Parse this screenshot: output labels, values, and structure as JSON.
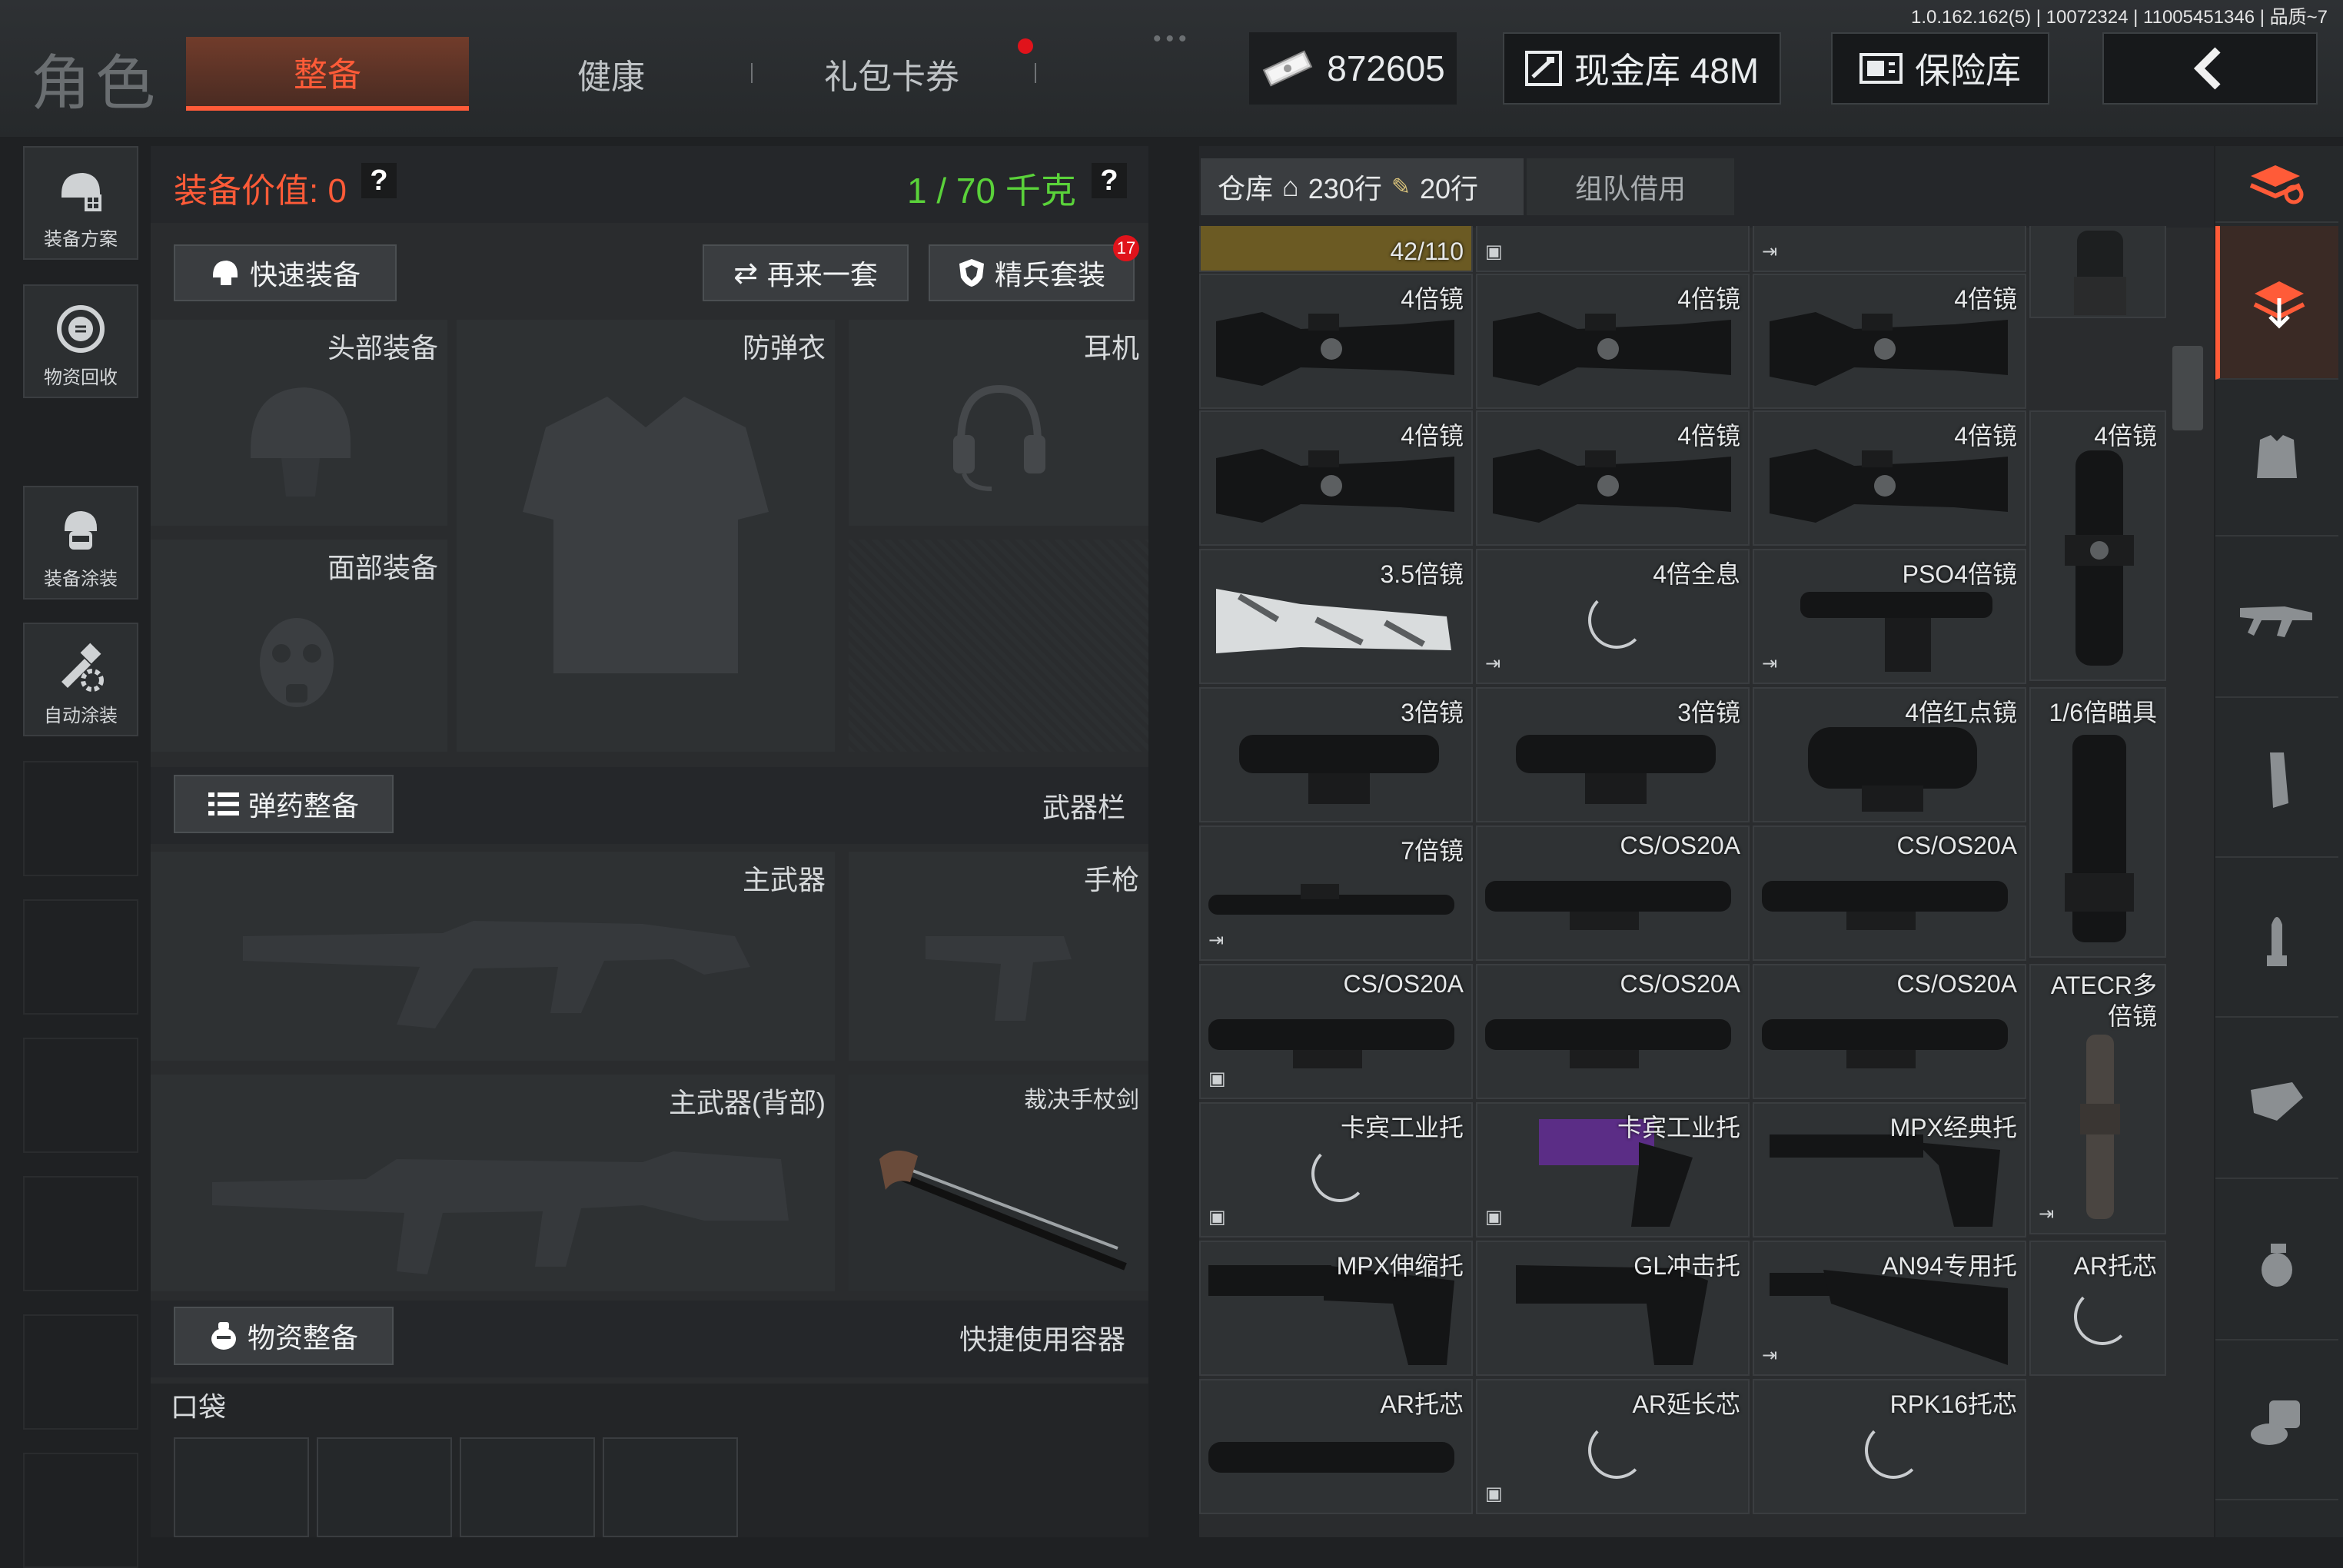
{
  "version": "1.0.162.162(5) | 10072324 | 11005451346 | 品质~7",
  "header": {
    "title": "角色",
    "tabs": [
      {
        "label": "整备",
        "active": true
      },
      {
        "label": "健康",
        "active": false
      },
      {
        "label": "礼包卡券",
        "active": false
      }
    ],
    "currency": "872605",
    "cash_vault": "现金库 48M",
    "safe_box": "保险库"
  },
  "left_nav": [
    {
      "label": "装备方案",
      "icon": "helmet-plan-icon"
    },
    {
      "label": "物资回收",
      "icon": "recycle-icon"
    },
    {
      "label": "装备涂装",
      "icon": "paint-soldier-icon"
    },
    {
      "label": "自动涂装",
      "icon": "auto-paint-icon"
    }
  ],
  "loadout": {
    "value_label": "装备价值: 0",
    "weight_label": "1 / 70 千克",
    "help": "?",
    "quick_equip": "快速装备",
    "repeat_set": "再来一套",
    "elite_set": "精兵套装",
    "elite_badge": "17",
    "slots": {
      "head": "头部装备",
      "armor": "防弹衣",
      "headset": "耳机",
      "face": "面部装备"
    },
    "ammo_equip": "弹药整备",
    "weapon_bar": "武器栏",
    "primary": "主武器",
    "pistol": "手枪",
    "primary_back": "主武器(背部)",
    "melee": "裁决手杖剑",
    "supplies_equip": "物资整备",
    "quick_container": "快捷使用容器",
    "pocket": "口袋"
  },
  "warehouse": {
    "tab": "仓库",
    "rows_total": "230行",
    "rows_used": "20行",
    "team_borrow": "组队借用",
    "capacity": "42/110",
    "items": [
      {
        "label": "4倍镜"
      },
      {
        "label": "4倍镜"
      },
      {
        "label": "4倍镜"
      },
      {
        "label": "4倍镜"
      },
      {
        "label": "4倍镜"
      },
      {
        "label": "4倍镜"
      },
      {
        "label": "4倍镜"
      },
      {
        "label": "3.5倍镜"
      },
      {
        "label": "4倍全息"
      },
      {
        "label": "PSO4倍镜"
      },
      {
        "label": "3倍镜"
      },
      {
        "label": "3倍镜"
      },
      {
        "label": "4倍红点镜"
      },
      {
        "label": "1/6倍瞄具"
      },
      {
        "label": "7倍镜"
      },
      {
        "label": "CS/OS20A"
      },
      {
        "label": "CS/OS20A"
      },
      {
        "label": "CS/OS20A"
      },
      {
        "label": "CS/OS20A"
      },
      {
        "label": "CS/OS20A"
      },
      {
        "label": "ATECR多倍镜"
      },
      {
        "label": "卡宾工业托"
      },
      {
        "label": "卡宾工业托"
      },
      {
        "label": "MPX经典托"
      },
      {
        "label": "MPX伸缩托"
      },
      {
        "label": "GL冲击托"
      },
      {
        "label": "AN94专用托"
      },
      {
        "label": "AR托芯"
      },
      {
        "label": "AR托芯"
      },
      {
        "label": "AR延长芯"
      },
      {
        "label": "RPK16托芯"
      }
    ]
  },
  "colors": {
    "accent": "#ff5b38",
    "weight_green": "#5ad23a",
    "badge_red": "#e0131b"
  }
}
